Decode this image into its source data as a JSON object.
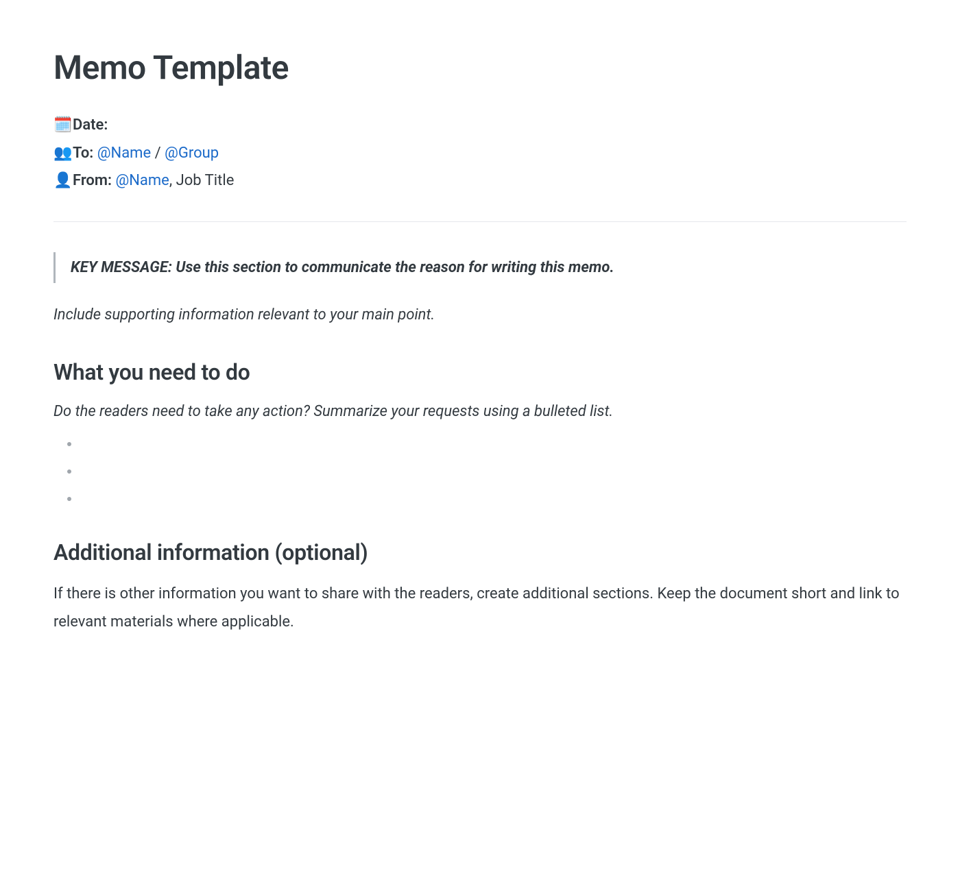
{
  "title": "Memo Template",
  "meta": {
    "date_icon": "🗓️",
    "date_label": "Date:",
    "to_icon": "👥",
    "to_label": "To:",
    "to_name": "@Name",
    "to_separator": " / ",
    "to_group": "@Group",
    "from_icon": "👤",
    "from_label": "From:",
    "from_name": "@Name",
    "from_suffix": ", Job Title"
  },
  "key_message": "KEY MESSAGE: Use this section to communicate the reason for writing this memo.",
  "supporting_text": "Include supporting information relevant to your main point.",
  "section_actions": {
    "heading": "What you need to do",
    "prompt": "Do the readers need to take any action? Summarize your requests using a bulleted list.",
    "items": [
      "",
      "",
      ""
    ]
  },
  "section_additional": {
    "heading": "Additional information (optional)",
    "body": "If there is other information you want to share with the readers, create additional sections. Keep the document short and link to relevant materials where applicable."
  }
}
